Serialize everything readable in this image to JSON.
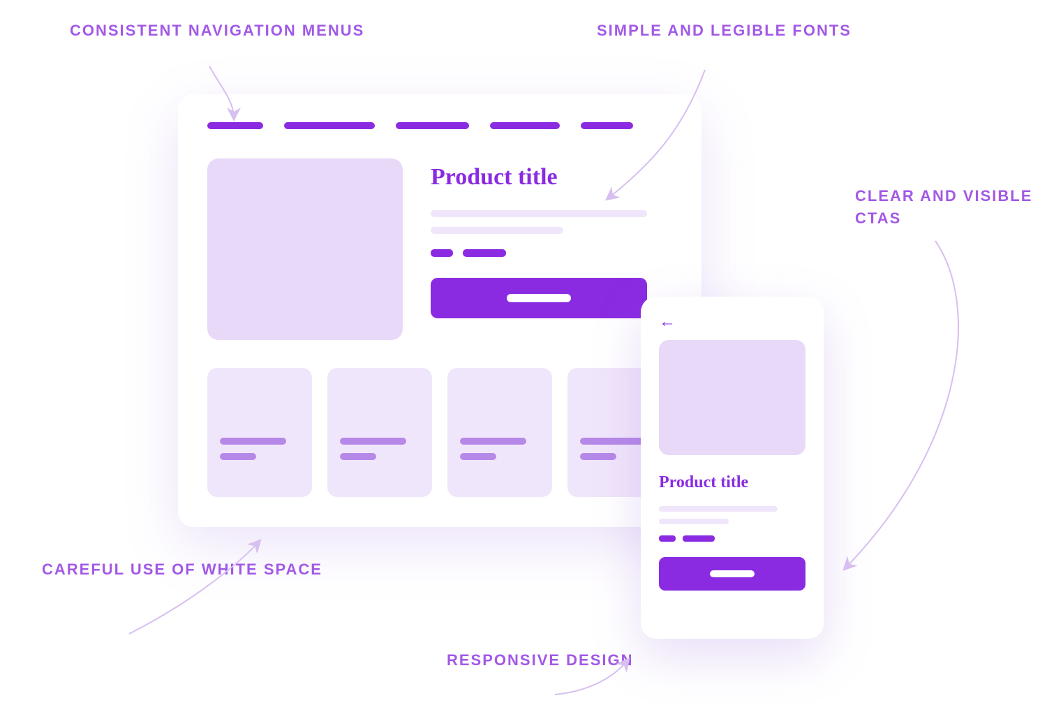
{
  "annotations": {
    "navigation": "Consistent navigation menus",
    "fonts": "Simple and legible fonts",
    "ctas": "Clear and visible CTAs",
    "whitespace": "Careful use of white space",
    "responsive": "Responsive design"
  },
  "desktop": {
    "product_title": "Product title"
  },
  "mobile": {
    "product_title": "Product title"
  },
  "colors": {
    "accent": "#8a2be2",
    "light_fill": "#e8d9f8",
    "lighter_fill": "#f0e6fb"
  }
}
